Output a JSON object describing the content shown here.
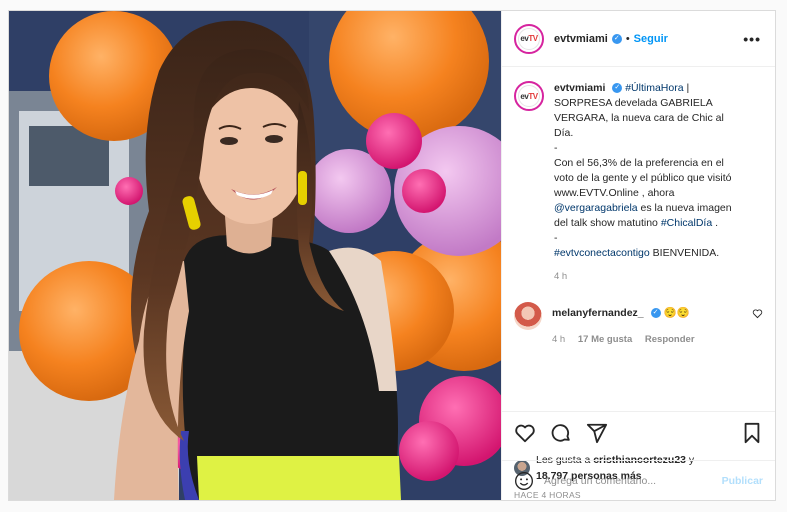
{
  "post": {
    "username": "evtvmiami",
    "follow_label": "Seguir",
    "more_label": "•••",
    "avatar_text_a": "ev",
    "avatar_text_b": "TV"
  },
  "caption": {
    "username": "evtvmiami",
    "hashtag_breaking": "#ÚltimaHora",
    "text_1": " | SORPRESA develada GABRIELA VERGARA, la nueva cara de Chic al Día.",
    "dash_1": "-",
    "text_2": "Con el 56,3% de la preferencia en el voto de la gente y el público que visitó www.EVTV.Online , ahora ",
    "mention": "@vergaragabriela",
    "text_3": " es la nueva imagen del talk show matutino ",
    "hashtag_show": "#ChicalDía",
    "text_4": " .",
    "dash_2": "-",
    "hashtag_end": "#evtvconectacontigo",
    "text_5": " BIENVENIDA.",
    "time": "4 h"
  },
  "comment": {
    "username": "melanyfernandez_",
    "text": "😌😌",
    "time": "4 h",
    "likes": "17 Me gusta",
    "reply": "Responder"
  },
  "likes": {
    "prefix": "Les gusta a ",
    "user": "cristhiancortezu23",
    "mid": " y ",
    "count": "18.797 personas más"
  },
  "posted_ago": "HACE 4 HORAS",
  "add_comment": {
    "placeholder": "Agrega un comentario...",
    "publish_label": "Publicar"
  }
}
